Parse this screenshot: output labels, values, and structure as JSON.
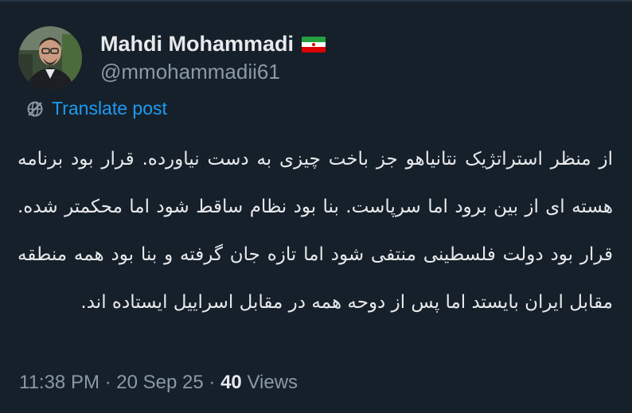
{
  "author": {
    "name": "Mahdi Mohammadi",
    "handle": "@mmohammadii61",
    "flag_icon": "iran-flag-icon"
  },
  "translate": {
    "icon": "translate-globe-icon",
    "label": "Translate post"
  },
  "tweet": {
    "text": "از منظر استراتژیک نتانیاهو جز باخت چیزی به دست نیاورده. قرار بود برنامه هسته ای از بین برود اما سرپاست. بنا بود نظام ساقط شود اما محکمتر شده. قرار بود دولت فلسطینی منتفی شود اما تازه جان گرفته و بنا بود همه منطقه مقابل ایران بایستد اما پس از دوحه همه در مقابل اسراییل ایستاده اند."
  },
  "meta": {
    "time": "11:38 PM",
    "separator": "·",
    "date": "20 Sep 25",
    "views_count": "40",
    "views_label": "Views"
  },
  "colors": {
    "background": "#15202b",
    "text": "#e7e9ea",
    "muted": "#8b98a5",
    "link": "#1d9bf0"
  }
}
